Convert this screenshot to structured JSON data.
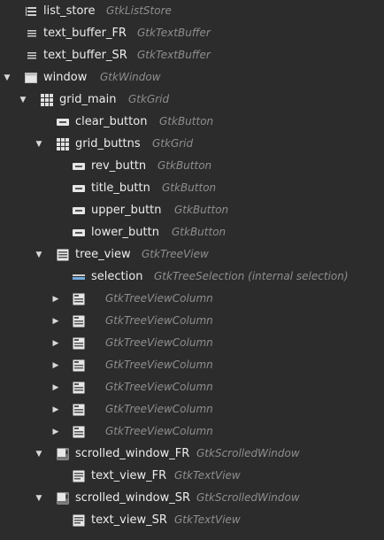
{
  "rows": [
    {
      "name": "list_store",
      "type": "GtkListStore",
      "icon": "list-store-icon",
      "expander": ""
    },
    {
      "name": "text_buffer_FR",
      "type": "GtkTextBuffer",
      "icon": "text-buffer-icon",
      "expander": ""
    },
    {
      "name": "text_buffer_SR",
      "type": "GtkTextBuffer",
      "icon": "text-buffer-icon",
      "expander": ""
    },
    {
      "name": "window",
      "type": "GtkWindow",
      "icon": "window-icon",
      "expander": "expanded"
    },
    {
      "name": "grid_main",
      "type": "GtkGrid",
      "icon": "grid-icon",
      "expander": "expanded"
    },
    {
      "name": "clear_button",
      "type": "GtkButton",
      "icon": "button-icon",
      "expander": ""
    },
    {
      "name": "grid_buttns",
      "type": "GtkGrid",
      "icon": "grid-icon",
      "expander": "expanded"
    },
    {
      "name": "rev_buttn",
      "type": "GtkButton",
      "icon": "button-icon",
      "expander": ""
    },
    {
      "name": "title_buttn",
      "type": "GtkButton",
      "icon": "button-icon",
      "expander": ""
    },
    {
      "name": "upper_buttn",
      "type": "GtkButton",
      "icon": "button-icon",
      "expander": ""
    },
    {
      "name": "lower_buttn",
      "type": "GtkButton",
      "icon": "button-icon",
      "expander": ""
    },
    {
      "name": "tree_view",
      "type": "GtkTreeView",
      "icon": "tree-view-icon",
      "expander": "expanded"
    },
    {
      "name": "selection",
      "type": "GtkTreeSelection  (internal selection)",
      "icon": "tree-selection-icon",
      "expander": ""
    },
    {
      "name": "",
      "type": "GtkTreeViewColumn",
      "icon": "tree-view-column-icon",
      "expander": "collapsed"
    },
    {
      "name": "",
      "type": "GtkTreeViewColumn",
      "icon": "tree-view-column-icon",
      "expander": "collapsed"
    },
    {
      "name": "",
      "type": "GtkTreeViewColumn",
      "icon": "tree-view-column-icon",
      "expander": "collapsed"
    },
    {
      "name": "",
      "type": "GtkTreeViewColumn",
      "icon": "tree-view-column-icon",
      "expander": "collapsed"
    },
    {
      "name": "",
      "type": "GtkTreeViewColumn",
      "icon": "tree-view-column-icon",
      "expander": "collapsed"
    },
    {
      "name": "",
      "type": "GtkTreeViewColumn",
      "icon": "tree-view-column-icon",
      "expander": "collapsed"
    },
    {
      "name": "",
      "type": "GtkTreeViewColumn",
      "icon": "tree-view-column-icon",
      "expander": "collapsed"
    },
    {
      "name": "scrolled_window_FR",
      "type": "GtkScrolledWindow",
      "icon": "scrolled-window-icon",
      "expander": "expanded"
    },
    {
      "name": "text_view_FR",
      "type": "GtkTextView",
      "icon": "text-view-icon",
      "expander": ""
    },
    {
      "name": "scrolled_window_SR",
      "type": "GtkScrolledWindow",
      "icon": "scrolled-window-icon",
      "expander": "expanded"
    },
    {
      "name": "text_view_SR",
      "type": "GtkTextView",
      "icon": "text-view-icon",
      "expander": ""
    }
  ]
}
